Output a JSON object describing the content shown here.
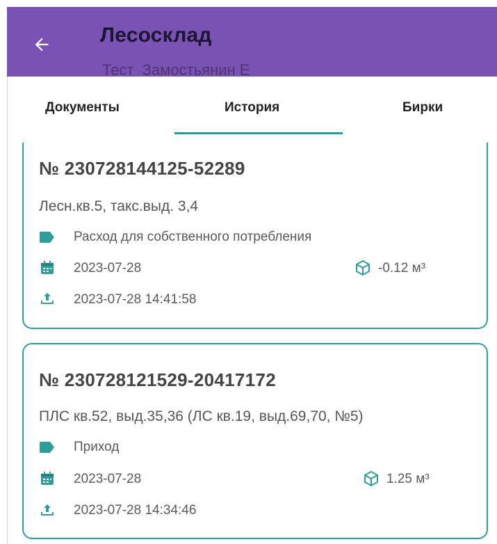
{
  "header": {
    "title": "Лесосклад",
    "subtitle": "Тест  Замостьянин Е"
  },
  "tabs": [
    {
      "label": "Документы",
      "active": false
    },
    {
      "label": "История",
      "active": true
    },
    {
      "label": "Бирки",
      "active": false
    }
  ],
  "documents": [
    {
      "number": "№ 230728144125-52289",
      "place": "Лесн.кв.5, такс.выд. 3,4",
      "operation": "Расход для собственного потребления",
      "date": "2023-07-28",
      "volume": "-0.12 м³",
      "uploaded": "2023-07-28 14:41:58"
    },
    {
      "number": "№ 230728121529-20417172",
      "place": "ПЛС кв.52, выд.35,36 (ЛС кв.19, выд.69,70, №5)",
      "operation": "Приход",
      "date": "2023-07-28",
      "volume": "1.25 м³",
      "uploaded": "2023-07-28 14:34:46"
    }
  ],
  "colors": {
    "appbar": "#7a52b3",
    "accent": "#2f9d9a"
  },
  "icons": [
    "arrow-left-icon",
    "label-tag-icon",
    "calendar-icon",
    "cube-icon",
    "upload-icon"
  ]
}
